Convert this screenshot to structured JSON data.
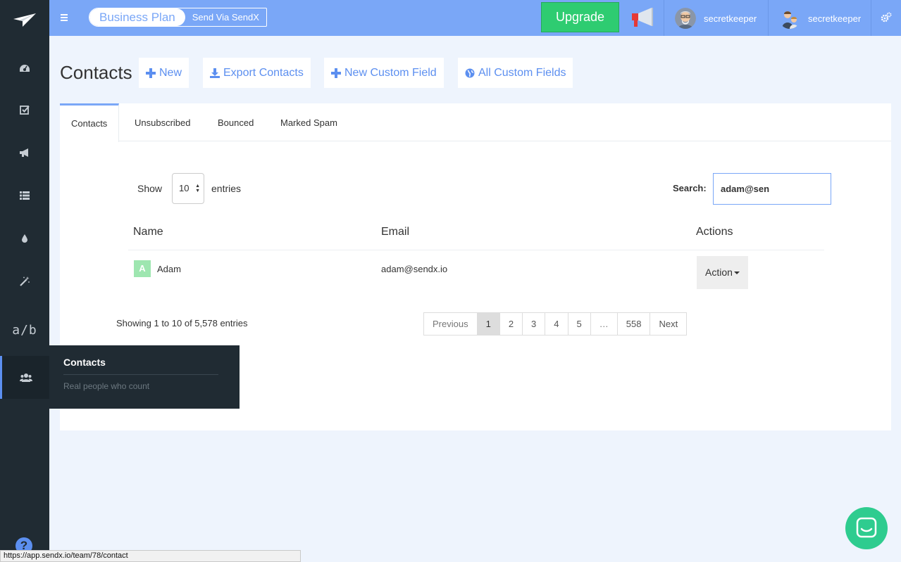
{
  "topbar": {
    "plan_name": "Business Plan",
    "send_via": "Send Via SendX",
    "upgrade_label": "Upgrade",
    "users": [
      {
        "name": "secretkeeper"
      },
      {
        "name": "secretkeeper"
      }
    ]
  },
  "sidebar": {
    "items": [
      {
        "icon": "dashboard-icon"
      },
      {
        "icon": "checkbox-icon"
      },
      {
        "icon": "megaphone-icon"
      },
      {
        "icon": "list-icon"
      },
      {
        "icon": "drop-icon"
      },
      {
        "icon": "magic-wand-icon"
      },
      {
        "icon": "ab-test-icon",
        "label": "a/b"
      },
      {
        "icon": "users-icon"
      }
    ],
    "tooltip": {
      "title": "Contacts",
      "subtitle": "Real people who count"
    }
  },
  "header": {
    "title": "Contacts",
    "buttons": [
      {
        "label": "New"
      },
      {
        "label": "Export Contacts"
      },
      {
        "label": "New Custom Field"
      },
      {
        "label": "All Custom Fields"
      }
    ]
  },
  "tabs": [
    {
      "label": "Contacts"
    },
    {
      "label": "Unsubscribed"
    },
    {
      "label": "Bounced"
    },
    {
      "label": "Marked Spam"
    }
  ],
  "table_controls": {
    "show_label": "Show",
    "entries_per_page": "10",
    "entries_label": "entries",
    "search_label": "Search:",
    "search_value": "adam@sen"
  },
  "table": {
    "columns": [
      "Name",
      "Email",
      "Actions"
    ],
    "rows": [
      {
        "initial": "A",
        "name": "Adam",
        "email": "adam@sendx.io",
        "action_label": "Action"
      }
    ],
    "info": "Showing 1 to 10 of 5,578 entries"
  },
  "pagination": {
    "previous": "Previous",
    "pages": [
      "1",
      "2",
      "3",
      "4",
      "5",
      "…",
      "558"
    ],
    "next": "Next"
  },
  "help_label": "?",
  "status_url": "https://app.sendx.io/team/78/contact",
  "colors": {
    "sidebar": "#202b33",
    "topbar": "#7aa7f7",
    "accent": "#5c8ff0",
    "upgrade": "#2ecc71",
    "chat": "#2ecc8f"
  }
}
